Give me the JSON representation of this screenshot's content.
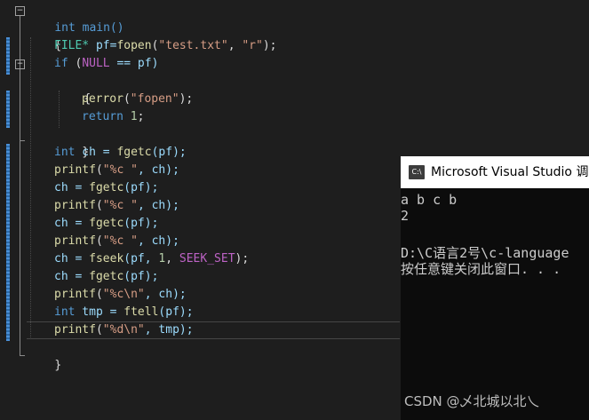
{
  "editor": {
    "lines": {
      "l1": "int main()",
      "l2": "{",
      "l3a": "FILE*",
      "l3b": " pf=",
      "l3c": "fopen",
      "l3d": "(",
      "l3e": "\"test.txt\"",
      "l3f": ", ",
      "l3g": "\"r\"",
      "l3h": ");",
      "l4a": "if",
      "l4b": " (",
      "l4c": "NULL",
      "l4d": " == pf)",
      "l5": "{",
      "l6a": "perror",
      "l6b": "(",
      "l6c": "\"fopen\"",
      "l6d": ");",
      "l7a": "return",
      "l7b": " ",
      "l7c": "1",
      "l7d": ";",
      "l8": "}",
      "l9a": "int",
      "l9b": " ch = ",
      "l9c": "fgetc",
      "l9d": "(pf);",
      "l10a": "printf",
      "l10b": "(",
      "l10c": "\"%c \"",
      "l10d": ", ch);",
      "l11a": "ch = ",
      "l11b": "fgetc",
      "l11c": "(pf);",
      "l12a": "printf",
      "l12b": "(",
      "l12c": "\"%c \"",
      "l12d": ", ch);",
      "l13a": "ch = ",
      "l13b": "fgetc",
      "l13c": "(pf);",
      "l14a": "printf",
      "l14b": "(",
      "l14c": "\"%c \"",
      "l14d": ", ch);",
      "l15a": "ch = ",
      "l15b": "fseek",
      "l15c": "(pf, ",
      "l15d": "1",
      "l15e": ", ",
      "l15f": "SEEK_SET",
      "l15g": ");",
      "l16a": "ch = ",
      "l16b": "fgetc",
      "l16c": "(pf);",
      "l17a": "printf",
      "l17b": "(",
      "l17c": "\"%c\\n\"",
      "l17d": ", ch);",
      "l18a": "int",
      "l18b": " tmp = ",
      "l18c": "ftell",
      "l18d": "(pf);",
      "l19a": "printf",
      "l19b": "(",
      "l19c": "\"%d\\n\"",
      "l19d": ", tmp);",
      "l20": "}"
    },
    "fold_glyph": "−"
  },
  "console": {
    "icon_text": "C:\\",
    "title": "Microsoft Visual Studio 调",
    "output": [
      "a b c b",
      "2",
      "",
      "D:\\C语言2号\\c-language",
      "按任意键关闭此窗口. . ."
    ]
  },
  "watermark": "CSDN @乄北城以北乀"
}
